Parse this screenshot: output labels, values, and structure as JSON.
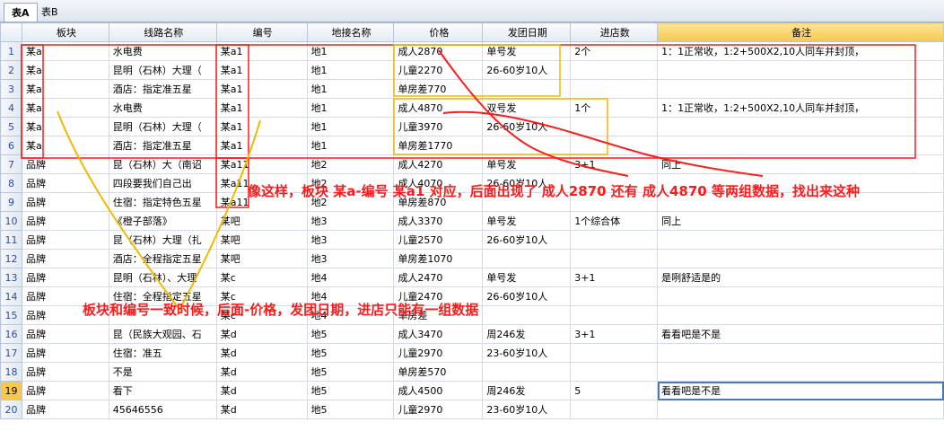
{
  "tabs": [
    {
      "label": "表A",
      "active": true
    },
    {
      "label": "表B",
      "active": false
    }
  ],
  "columns": [
    "板块",
    "线路名称",
    "编号",
    "地接名称",
    "价格",
    "发团日期",
    "进店数",
    "备注"
  ],
  "rows": [
    [
      "某a",
      "水电费",
      "某a1",
      "地1",
      "成人2870",
      "单号发",
      "2个",
      "1：1正常收，1:2+500X2,10人同车并封顶，"
    ],
    [
      "某a",
      "昆明（石林）大理（",
      "某a1",
      "地1",
      "儿童2270",
      "26-60岁10人",
      "",
      ""
    ],
    [
      "某a",
      "酒店：指定准五星",
      "某a1",
      "地1",
      "单房差770",
      "",
      "",
      ""
    ],
    [
      "某a",
      "水电费",
      "某a1",
      "地1",
      "成人4870",
      "双号发",
      "1个",
      "1：1正常收，1:2+500X2,10人同车并封顶，"
    ],
    [
      "某a",
      "昆明（石林）大理（",
      "某a1",
      "地1",
      "儿童3970",
      "26-60岁10人",
      "",
      ""
    ],
    [
      "某a",
      "酒店：指定准五星",
      "某a1",
      "地1",
      "单房差1770",
      "",
      "",
      ""
    ],
    [
      "品牌",
      "昆（石林）大（南诏",
      "某a11",
      "地2",
      "成人4270",
      "单号发",
      "3+1",
      "同上"
    ],
    [
      "品牌",
      "四段要我们自己出",
      "某a11",
      "地2",
      "成人4070",
      "26-60岁10人",
      "",
      ""
    ],
    [
      "品牌",
      "住宿：指定特色五星",
      "某a11",
      "地2",
      "单房差870",
      "",
      "",
      ""
    ],
    [
      "品牌",
      "《橙子部落》",
      "某吧",
      "地3",
      "成人3370",
      "单号发",
      "1个综合体",
      "同上"
    ],
    [
      "品牌",
      "昆（石林）大理（扎",
      "某吧",
      "地3",
      "儿童2570",
      "26-60岁10人",
      "",
      ""
    ],
    [
      "品牌",
      "酒店：全程指定五星",
      "某吧",
      "地3",
      "单房差1070",
      "",
      "",
      ""
    ],
    [
      "品牌",
      "昆明（石林）、大理",
      "某c",
      "地4",
      "成人2470",
      "单号发",
      "3+1",
      "是咧舒适是的"
    ],
    [
      "品牌",
      "住宿：全程指定五星",
      "某c",
      "地4",
      "儿童2470",
      "26-60岁10人",
      "",
      ""
    ],
    [
      "品牌",
      "",
      "某c",
      "地4",
      "单房差",
      "",
      "",
      ""
    ],
    [
      "品牌",
      "昆（民族大观园、石",
      "某d",
      "地5",
      "成人3470",
      "周246发",
      "3+1",
      "看看吧是不是"
    ],
    [
      "品牌",
      "住宿：准五",
      "某d",
      "地5",
      "儿童2970",
      "23-60岁10人",
      "",
      ""
    ],
    [
      "品牌",
      "不是",
      "某d",
      "地5",
      "单房差570",
      "",
      "",
      ""
    ],
    [
      "品牌",
      "看下",
      "某d",
      "地5",
      "成人4500",
      "周246发",
      "5",
      "看看吧是不是"
    ],
    [
      "品牌",
      "45646556",
      "某d",
      "地5",
      "儿童2970",
      "23-60岁10人",
      "",
      ""
    ]
  ],
  "annotations": {
    "note1": "像这样，板块 某a-编号 某a1 对应，后面出现了 成人2870 还有 成人4870 等两组数据，找出来这种",
    "note2": "板块和编号一致时候，后面-价格，发团日期，进店只能有一组数据"
  },
  "colors": {
    "red_box": "#ff1a1a",
    "orange_box": "#f2b800",
    "annotation_text": "#ff1a1a",
    "active_header": "#f6c84c",
    "row_header_text": "#2a4ea8"
  }
}
